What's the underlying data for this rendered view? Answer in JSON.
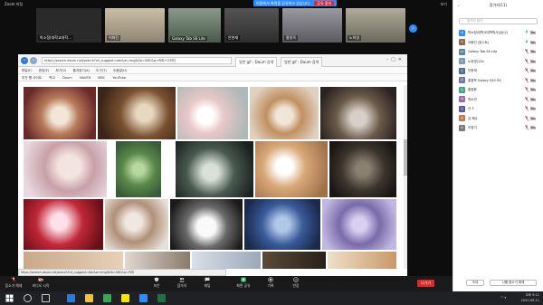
{
  "zoom": {
    "brand": "Zoom 미팅",
    "share_banner": "미팅에서 화면을 공유하고 있습니다",
    "stop_share": "공유 중지",
    "view_button": "보기",
    "thumbnails": [
      {
        "name": "박소정(대학교대학...",
        "color": "#3a3a3a"
      },
      {
        "name": "이화진",
        "color": "#b8b0a0"
      },
      {
        "name": "Galaxy Tab S6 Lite",
        "color": "#6a7a6a"
      },
      {
        "name": "안현재",
        "color": "#4a4a4a"
      },
      {
        "name": "홍명옥",
        "color": "#7a7a80"
      },
      {
        "name": "노하영",
        "color": "#8a8a7a"
      }
    ],
    "active_speaker": "박소정(대학교대학박사님)",
    "controls": [
      {
        "label": "음소거 해제",
        "icon": "microphone-muted-icon",
        "color": "#e02828"
      },
      {
        "label": "비디오 시작",
        "icon": "video-off-icon",
        "color": "#e02828"
      },
      {
        "label": "보안",
        "icon": "shield-icon",
        "color": "#ddd"
      },
      {
        "label": "참가자",
        "icon": "participants-icon",
        "color": "#ddd"
      },
      {
        "label": "채팅",
        "icon": "chat-icon",
        "color": "#ddd"
      },
      {
        "label": "화면 공유",
        "icon": "share-screen-icon",
        "color": "#2dcc70"
      },
      {
        "label": "기록",
        "icon": "record-icon",
        "color": "#ddd"
      },
      {
        "label": "반응",
        "icon": "reactions-icon",
        "color": "#ddd"
      }
    ],
    "end_button": "나가기"
  },
  "browser": {
    "address": "https://search.daum.net/search?nil_suggest=btn&w=img&DA=SBC&q=커피+이미지",
    "tabs": [
      {
        "label": "일반 gif - Daum 검색"
      },
      {
        "label": "일반 gif - Daum 검색"
      }
    ],
    "menu": [
      "파일(F)",
      "편집(E)",
      "보기(V)",
      "즐겨찾기(A)",
      "도구(T)",
      "도움말(H)"
    ],
    "favorites": [
      "추천 웹 사이트",
      "학교",
      "Daum",
      "NAVER",
      "MBC",
      "YouTube"
    ],
    "status": "https://search.daum.net/search?nil_suggest=btn&w=img&DA=SBC&q=커피"
  },
  "panel": {
    "title": "참가자(11)",
    "search_placeholder": "참가자 찾기",
    "participants": [
      {
        "name": "박소정(대학교대학박사님)(나)",
        "initials": "박",
        "color": "#2d8cff",
        "mic": "on"
      },
      {
        "name": "이화진 (호스트)",
        "initials": "이",
        "color": "#8a6a4a",
        "mic": "on"
      },
      {
        "name": "Galaxy Tab S6 Lite",
        "initials": "GT",
        "color": "#5a8a9a",
        "mic": "off"
      },
      {
        "name": "노하영(134",
        "initials": "노",
        "color": "#7a9aba",
        "mic": "off"
      },
      {
        "name": "안현재",
        "initials": "안",
        "color": "#4a6a9a",
        "mic": "off"
      },
      {
        "name": "홍명옥 Galaxy S20 5G",
        "initials": "홍",
        "color": "#6a7aa8",
        "mic": "off"
      },
      {
        "name": "홍현화",
        "initials": "홍",
        "color": "#4aa08a",
        "mic": "off"
      },
      {
        "name": "박소연",
        "initials": "박",
        "color": "#9a6aaa",
        "mic": "off"
      },
      {
        "name": "신 3",
        "initials": "신",
        "color": "#5a5a9a",
        "mic": "off"
      },
      {
        "name": "김 혜수",
        "initials": "김",
        "color": "#c07a4a",
        "mic": "off"
      },
      {
        "name": "이정기",
        "initials": "이",
        "color": "#7a7a7a",
        "mic": "off"
      }
    ],
    "invite_button": "초대",
    "mute_all_button": "나를 음소거 해제"
  },
  "taskbar": {
    "apps": [
      {
        "icon": "windows-start-icon",
        "color": "#ffffff"
      },
      {
        "icon": "search-icon",
        "color": "#cccccc"
      },
      {
        "icon": "task-view-icon",
        "color": "#cccccc"
      },
      {
        "icon": "edge-icon",
        "color": "#2d7bd6"
      },
      {
        "icon": "file-explorer-icon",
        "color": "#f0c040"
      },
      {
        "icon": "chrome-icon",
        "color": "#3aa757"
      },
      {
        "icon": "kakao-icon",
        "color": "#f7e600"
      },
      {
        "icon": "zoom-icon",
        "color": "#2d8cff"
      },
      {
        "icon": "excel-icon",
        "color": "#1e7145"
      }
    ],
    "time": "오후 9:11",
    "date": "2020-09-11"
  }
}
